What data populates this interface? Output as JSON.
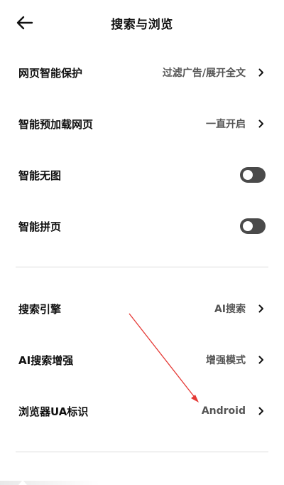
{
  "header": {
    "title": "搜索与浏览"
  },
  "sections": [
    {
      "items": [
        {
          "label": "网页智能保护",
          "value": "过滤广告/展开全文",
          "control": "chevron"
        },
        {
          "label": "智能预加载网页",
          "value": "一直开启",
          "control": "chevron"
        },
        {
          "label": "智能无图",
          "control": "toggle",
          "toggle_on": false
        },
        {
          "label": "智能拼页",
          "control": "toggle",
          "toggle_on": false
        }
      ]
    },
    {
      "items": [
        {
          "label": "搜索引擎",
          "value": "AI搜索",
          "control": "chevron"
        },
        {
          "label": "AI搜索增强",
          "value": "增强模式",
          "control": "chevron"
        },
        {
          "label": "浏览器UA标识",
          "value": "Android",
          "control": "chevron"
        }
      ]
    }
  ],
  "icons": {
    "back": "arrow-left-icon",
    "chevron": "chevron-right-icon"
  },
  "colors": {
    "background": "#ffffff",
    "text": "#111111",
    "secondary_text": "#555555",
    "toggle_off": "#4a4a4a",
    "divider": "#dcdcdc",
    "annotation": "#e53935"
  }
}
